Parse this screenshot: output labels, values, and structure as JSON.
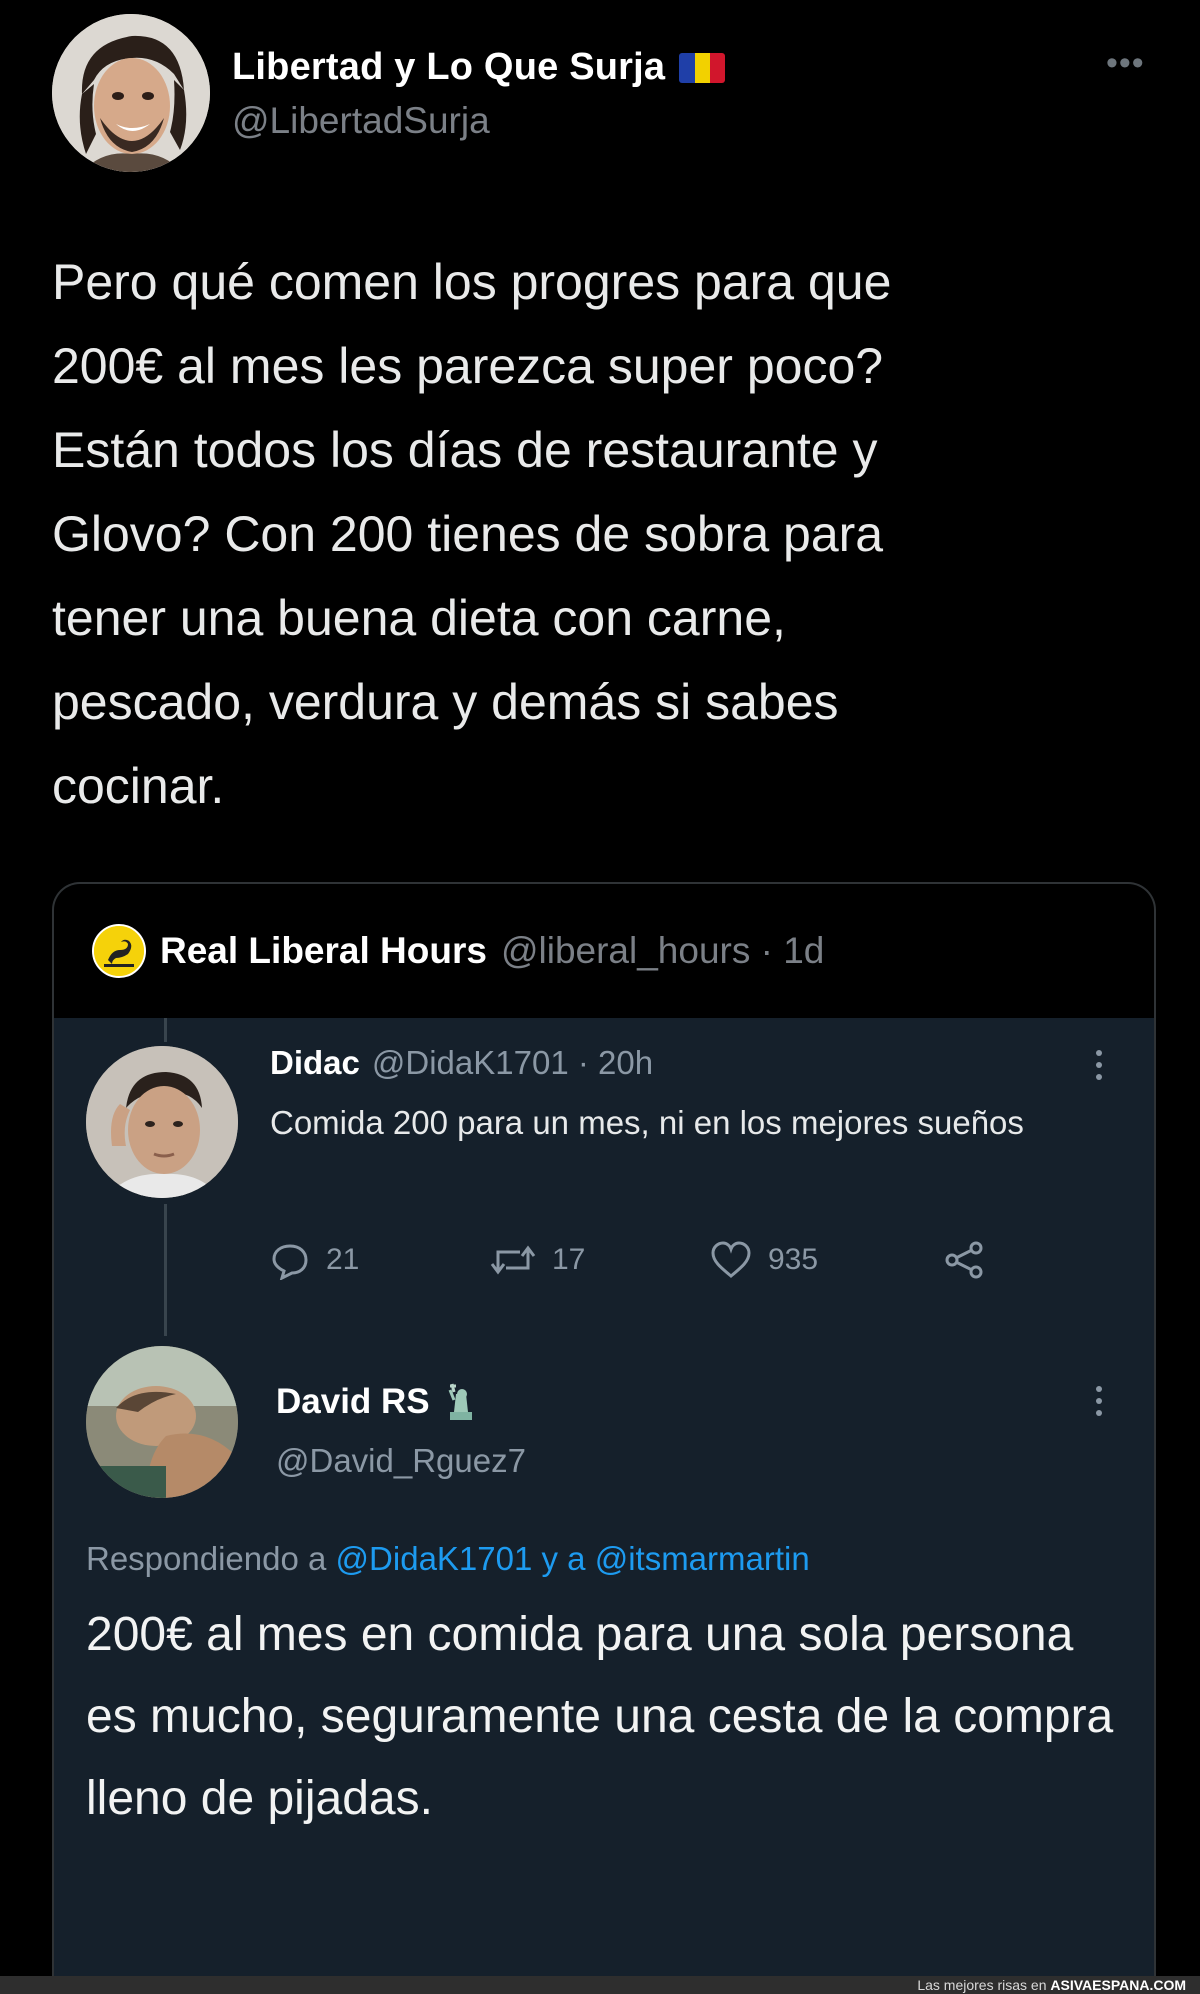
{
  "outer_tweet": {
    "display_name": "Libertad y Lo Que Surja",
    "handle": "@LibertadSurja",
    "badge": "andorra-flag-icon",
    "flag_colors": [
      "#1f3fa8",
      "#f2d100",
      "#d1162c"
    ],
    "text": "Pero qué comen los progres para que\n200€ al mes les parezca super poco?\nEstán todos los días de restaurante y\nGlovo? Con 200 tienes de sobra para\ntener una buena dieta con carne,\npescado, verdura y demás si sabes\ncocinar."
  },
  "quoted_tweet": {
    "display_name": "Real Liberal Hours",
    "handle_time": "@liberal_hours · 1d",
    "avatar_icon": "gadsden-flag-icon",
    "replies": [
      {
        "display_name": "Didac",
        "meta": "@DidaK1701 · 20h",
        "text": "Comida 200 para un mes, ni en los mejores sueños",
        "actions": {
          "reply_count": "21",
          "retweet_count": "17",
          "like_count": "935"
        }
      }
    ],
    "main_reply": {
      "display_name": "David RS",
      "badge": "statue-of-liberty-icon",
      "handle": "@David_Rguez7",
      "replying_prefix": "Respondiendo a",
      "replying_mentions": "@DidaK1701 y a @itsmarmartin",
      "text": "200€ al mes en comida para una sola persona es mucho, seguramente una cesta de la compra lleno de pijadas."
    }
  },
  "watermark": {
    "prefix": "Las mejores risas en",
    "site": "ASIVAESPANA.COM"
  },
  "colors": {
    "background": "#000000",
    "embedded_background": "#15202b",
    "mention_blue": "#1d9bf0",
    "secondary_text": "#8b98a5"
  }
}
